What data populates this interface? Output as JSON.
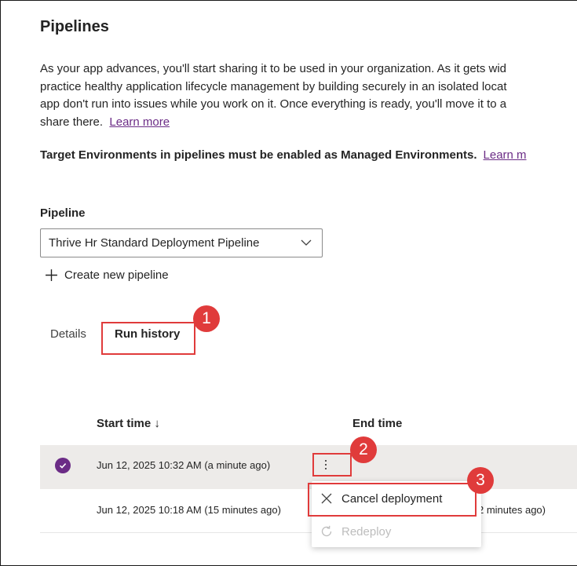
{
  "page": {
    "title": "Pipelines",
    "description_lines": [
      "As your app advances, you'll start sharing it to be used in your organization. As it gets wid",
      "practice healthy application lifecycle management by building securely in an isolated locat",
      "app don't run into issues while you work on it. Once everything is ready, you'll move it to a",
      "share there."
    ],
    "learn_more": "Learn more",
    "warning": "Target Environments in pipelines must be enabled as Managed Environments.",
    "warning_link": "Learn m"
  },
  "pipeline": {
    "label": "Pipeline",
    "selected": "Thrive Hr Standard Deployment Pipeline",
    "create_new": "Create new pipeline"
  },
  "tabs": [
    {
      "label": "Details",
      "active": false
    },
    {
      "label": "Run history",
      "active": true
    }
  ],
  "table": {
    "columns": [
      "Start time ↓",
      "End time"
    ],
    "rows": [
      {
        "start": "Jun 12, 2025 10:32 AM",
        "start_rel": "(a minute ago)",
        "end": "",
        "selected": true
      },
      {
        "start": "Jun 12, 2025 10:18 AM",
        "start_rel": "(15 minutes ago)",
        "end_partial": "2 minutes ago)",
        "selected": false
      }
    ]
  },
  "context_menu": {
    "items": [
      {
        "label": "Cancel deployment",
        "icon": "close-icon",
        "enabled": true
      },
      {
        "label": "Redeploy",
        "icon": "redeploy-icon",
        "enabled": false
      }
    ]
  },
  "annotations": {
    "badges": [
      "1",
      "2",
      "3"
    ],
    "color": "#e03b3b"
  },
  "colors": {
    "accent": "#6b2c86",
    "row_selected_bg": "#edebe9",
    "disabled_text": "#bdbdbd"
  }
}
